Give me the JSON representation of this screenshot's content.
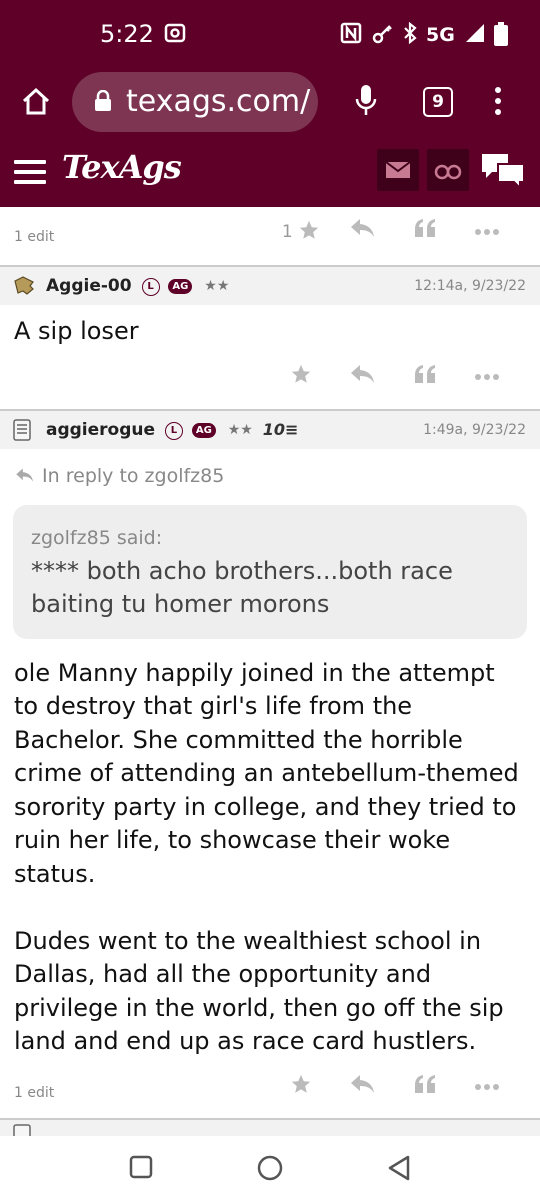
{
  "status": {
    "time": "5:22",
    "network": "5G"
  },
  "browser": {
    "url": "texags.com/",
    "tab_count": "9"
  },
  "site": {
    "logo": "TexAgs"
  },
  "prev_post": {
    "edit": "1 edit",
    "star_count": "1"
  },
  "posts": [
    {
      "username": "Aggie-00",
      "badge_l": "L",
      "badge_ag": "AG",
      "stars": "★★",
      "time": "12:14a, 9/23/22",
      "body": "A sip loser"
    },
    {
      "username": "aggierogue",
      "badge_l": "L",
      "badge_ag": "AG",
      "stars": "★★",
      "rank": "10≡",
      "time": "1:49a, 9/23/22",
      "reply_to": "In reply to zgolfz85",
      "quote_author": "zgolfz85 said:",
      "quote_text": "**** both acho brothers...both race baiting tu homer morons",
      "body": "ole Manny happily joined in the attempt to destroy that girl's life from the Bachelor. She committed the horrible crime of attending an antebellum-themed sorority party in college, and they tried to ruin her life, to showcase their woke status.\n\nDudes went to the wealthiest school in Dallas, had all the opportunity and privilege in the world, then go off the sip land and end up as race card hustlers.",
      "edit": "1 edit"
    }
  ],
  "colors": {
    "maroon": "#5e0027",
    "url_pill": "#7d3552",
    "icon_gray": "#bbbbbb"
  }
}
